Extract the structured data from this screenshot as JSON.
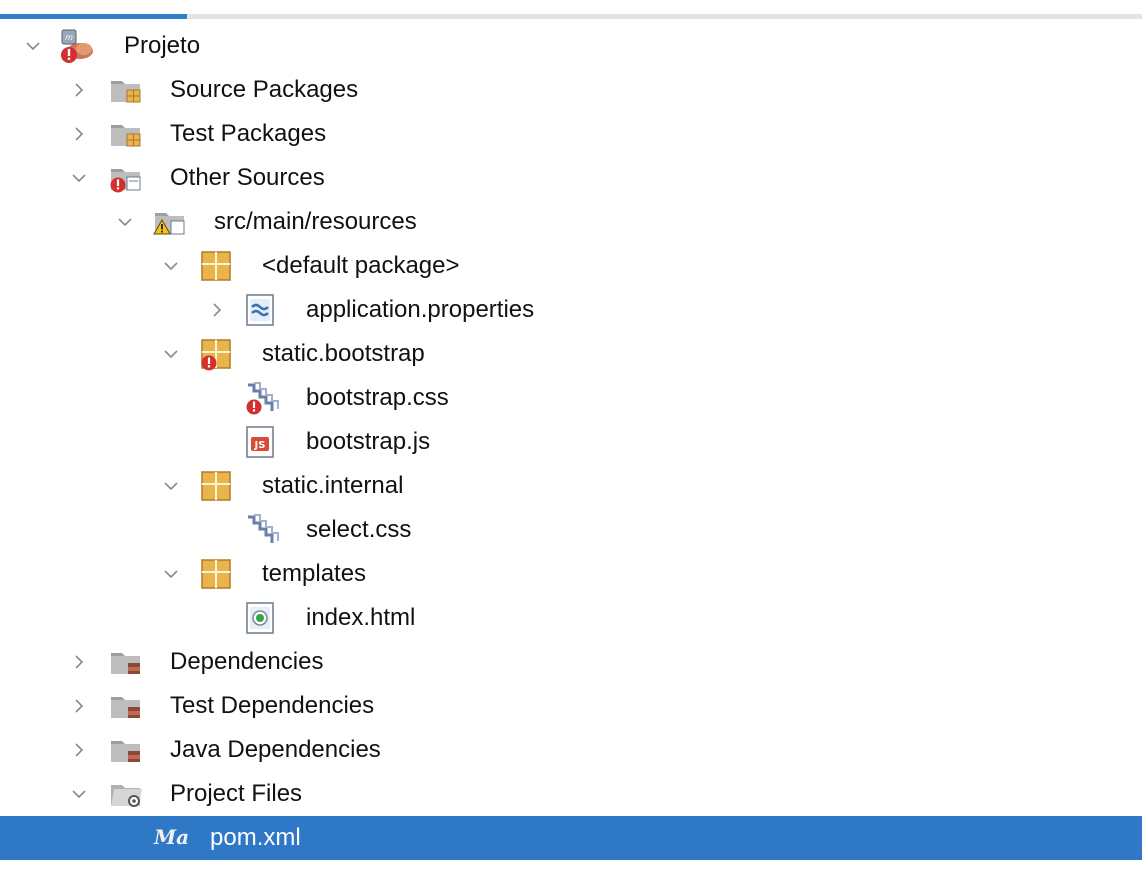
{
  "tree": {
    "items": [
      {
        "label": "Projeto",
        "level": 0,
        "expanded": true,
        "icon": "maven-project-icon"
      },
      {
        "label": "Source Packages",
        "level": 1,
        "expanded": false,
        "icon": "folder-package-icon"
      },
      {
        "label": "Test Packages",
        "level": 1,
        "expanded": false,
        "icon": "folder-package-icon"
      },
      {
        "label": "Other Sources",
        "level": 1,
        "expanded": true,
        "icon": "folder-error-icon"
      },
      {
        "label": "src/main/resources",
        "level": 2,
        "expanded": true,
        "icon": "folder-warning-icon"
      },
      {
        "label": "<default package>",
        "level": 3,
        "expanded": true,
        "icon": "package-icon"
      },
      {
        "label": "application.properties",
        "level": 4,
        "expanded": false,
        "icon": "properties-file-icon"
      },
      {
        "label": "static.bootstrap",
        "level": 3,
        "expanded": true,
        "icon": "package-error-icon"
      },
      {
        "label": "bootstrap.css",
        "level": 4,
        "expanded": null,
        "icon": "css-file-error-icon"
      },
      {
        "label": "bootstrap.js",
        "level": 4,
        "expanded": null,
        "icon": "js-file-icon"
      },
      {
        "label": "static.internal",
        "level": 3,
        "expanded": true,
        "icon": "package-icon"
      },
      {
        "label": "select.css",
        "level": 4,
        "expanded": null,
        "icon": "css-file-icon"
      },
      {
        "label": "templates",
        "level": 3,
        "expanded": true,
        "icon": "package-icon"
      },
      {
        "label": "index.html",
        "level": 4,
        "expanded": null,
        "icon": "html-file-icon"
      },
      {
        "label": "Dependencies",
        "level": 1,
        "expanded": false,
        "icon": "folder-library-icon"
      },
      {
        "label": "Test Dependencies",
        "level": 1,
        "expanded": false,
        "icon": "folder-library-icon"
      },
      {
        "label": "Java Dependencies",
        "level": 1,
        "expanded": false,
        "icon": "folder-library-icon"
      },
      {
        "label": "Project Files",
        "level": 1,
        "expanded": true,
        "icon": "folder-settings-icon"
      },
      {
        "label": "pom.xml",
        "level": 2,
        "expanded": null,
        "icon": "maven-file-icon",
        "selected": true
      }
    ]
  },
  "colors": {
    "selection": "#2f78c6",
    "accent_tab": "#2f7fc8",
    "package_yellow": "#e9b44c",
    "error_red": "#c62828"
  },
  "icon_text": {
    "maven_badge": "Ma",
    "js_badge": "JS"
  }
}
